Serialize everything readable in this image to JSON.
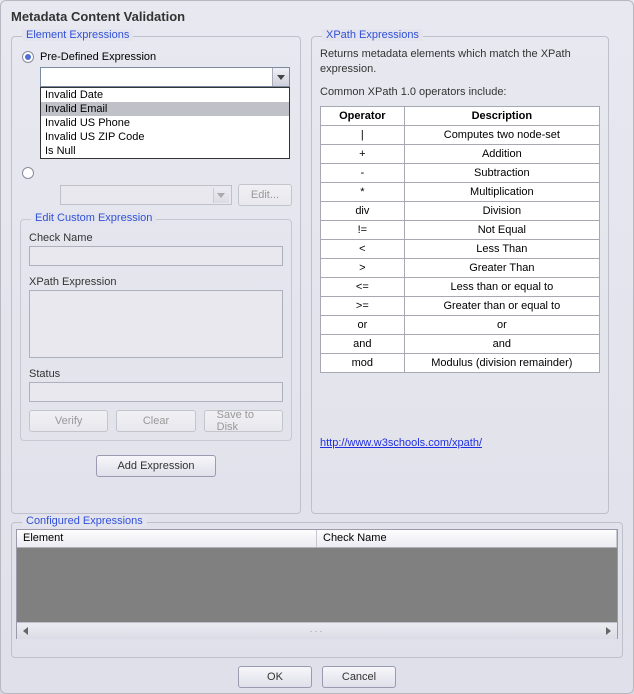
{
  "title": "Metadata Content Validation",
  "elemExpr": {
    "legend": "Element Expressions",
    "predefLabel": "Pre-Defined Expression",
    "dropdownOptions": [
      "Invalid Date",
      "Invalid Email",
      "Invalid US Phone",
      "Invalid US ZIP Code",
      "Is Null"
    ],
    "hoverIndex": 1,
    "editBtn": "Edit...",
    "editCustom": {
      "legend": "Edit Custom Expression",
      "checkName": "Check Name",
      "xpathExpr": "XPath Expression",
      "status": "Status",
      "verify": "Verify",
      "clear": "Clear",
      "save": "Save to Disk"
    },
    "addExpr": "Add Expression"
  },
  "xpathPanel": {
    "legend": "XPath Expressions",
    "intro": "Returns metadata elements which match the XPath expression.",
    "common": "Common XPath 1.0 operators include:",
    "opHeader": "Operator",
    "descHeader": "Description",
    "rows": [
      {
        "op": "|",
        "desc": "Computes two node-set"
      },
      {
        "op": "+",
        "desc": "Addition"
      },
      {
        "op": "-",
        "desc": "Subtraction"
      },
      {
        "op": "*",
        "desc": "Multiplication"
      },
      {
        "op": "div",
        "desc": "Division"
      },
      {
        "op": "!=",
        "desc": "Not Equal"
      },
      {
        "op": "<",
        "desc": "Less Than"
      },
      {
        "op": ">",
        "desc": "Greater Than"
      },
      {
        "op": "<=",
        "desc": "Less than or equal to"
      },
      {
        "op": ">=",
        "desc": "Greater than or equal to"
      },
      {
        "op": "or",
        "desc": "or"
      },
      {
        "op": "and",
        "desc": "and"
      },
      {
        "op": "mod",
        "desc": "Modulus (division remainder)"
      }
    ],
    "link": "http://www.w3schools.com/xpath/"
  },
  "configured": {
    "legend": "Configured Expressions",
    "col1": "Element",
    "col2": "Check Name"
  },
  "footer": {
    "ok": "OK",
    "cancel": "Cancel"
  }
}
